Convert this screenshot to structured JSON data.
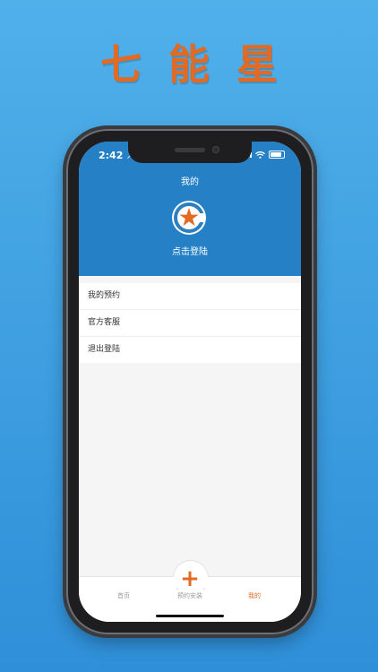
{
  "banner": {
    "title": "七能星"
  },
  "status": {
    "time": "2:42"
  },
  "header": {
    "title": "我的",
    "login_label": "点击登陆"
  },
  "menu": {
    "items": [
      {
        "label": "我的预约"
      },
      {
        "label": "官方客服"
      },
      {
        "label": "退出登陆"
      }
    ]
  },
  "tabbar": {
    "items": [
      {
        "label": "首页",
        "active": false
      },
      {
        "label": "预约安装",
        "active": false
      },
      {
        "label": "我的",
        "active": true
      }
    ],
    "fab_icon": "plus-icon"
  },
  "colors": {
    "accent": "#e26a22",
    "header_bg": "#2680c6",
    "background_top": "#4fb0ea",
    "background_bottom": "#2f8fd8"
  }
}
